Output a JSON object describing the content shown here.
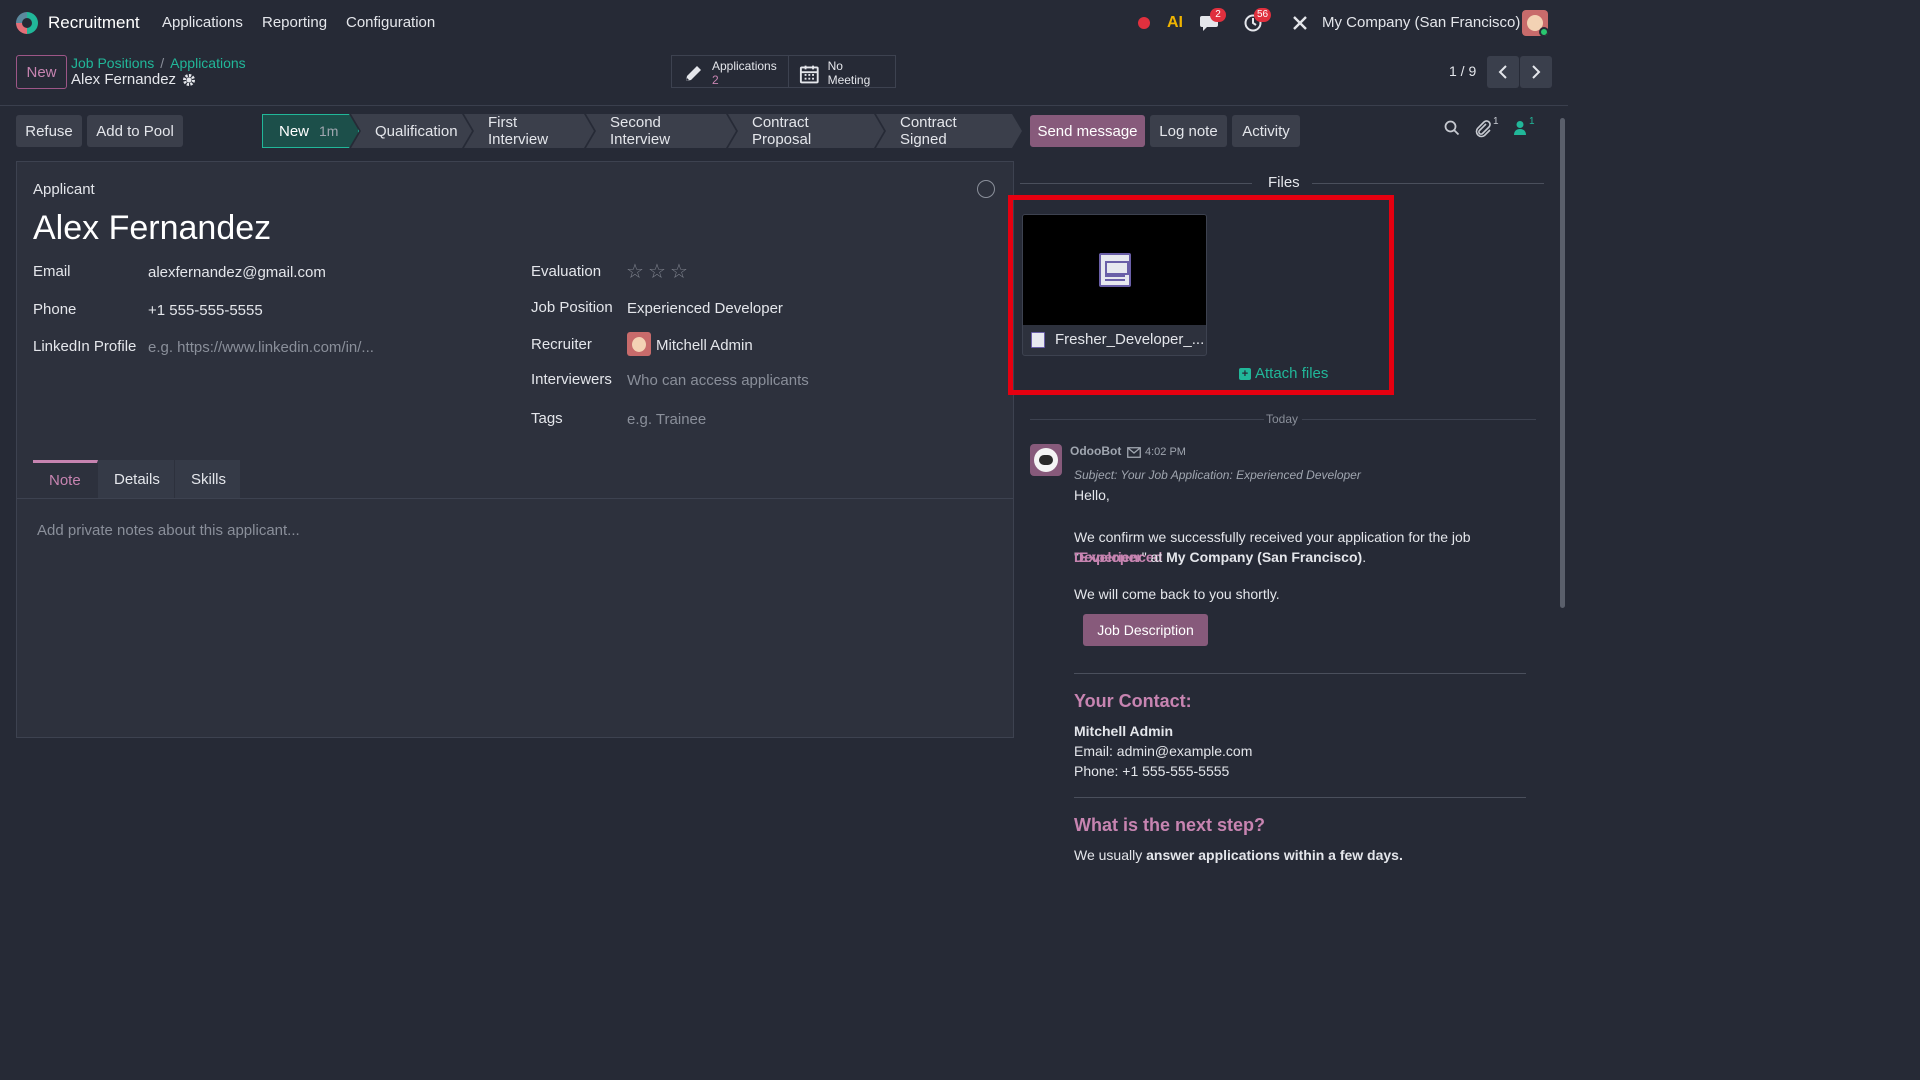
{
  "app": {
    "name": "Recruitment",
    "menu": [
      "Applications",
      "Reporting",
      "Configuration"
    ],
    "company": "My Company (San Francisco)",
    "messages_badge": "2",
    "activities_badge": "56",
    "ai_label": "AI"
  },
  "control": {
    "new_label": "New",
    "breadcrumb": [
      "Job Positions",
      "Applications"
    ],
    "record_title": "Alex Fernandez",
    "smart_buttons": {
      "applications_label": "Applications",
      "applications_count": "2",
      "meeting_label": "No Meeting"
    },
    "pager": "1 / 9"
  },
  "actions": {
    "refuse": "Refuse",
    "add_to_pool": "Add to Pool"
  },
  "stages": [
    {
      "label": "New",
      "age": "1m"
    },
    {
      "label": "Qualification"
    },
    {
      "label": "First Interview"
    },
    {
      "label": "Second Interview"
    },
    {
      "label": "Contract Proposal"
    },
    {
      "label": "Contract Signed"
    }
  ],
  "chatter_actions": {
    "send_message": "Send message",
    "log_note": "Log note",
    "activity": "Activity",
    "attachments_count": "1",
    "followers_count": "1"
  },
  "form": {
    "section_label": "Applicant",
    "name": "Alex Fernandez",
    "email_label": "Email",
    "email": "alexfernandez@gmail.com",
    "phone_label": "Phone",
    "phone": "+1 555-555-5555",
    "linkedin_label": "LinkedIn Profile",
    "linkedin_placeholder": "e.g. https://www.linkedin.com/in/...",
    "evaluation_label": "Evaluation",
    "evaluation_stars": 0,
    "job_position_label": "Job Position",
    "job_position": "Experienced Developer",
    "recruiter_label": "Recruiter",
    "recruiter": "Mitchell Admin",
    "interviewers_label": "Interviewers",
    "interviewers_placeholder": "Who can access applicants",
    "tags_label": "Tags",
    "tags_placeholder": "e.g. Trainee"
  },
  "tabs": [
    "Note",
    "Details",
    "Skills"
  ],
  "note_placeholder": "Add private notes about this applicant...",
  "files": {
    "heading": "Files",
    "file_name": "Fresher_Developer_...",
    "attach_label": "Attach files"
  },
  "chatter": {
    "date_separator": "Today",
    "author": "OdooBot",
    "time": "4:02 PM",
    "subject": "Subject: Your Job Application: Experienced Developer",
    "greeting": "Hello,",
    "line1_pre": "We confirm we successfully received your application for the job \"",
    "line1_job_a": "Experienced",
    "line1_job_b": "Developer",
    "line1_mid": "\" at ",
    "line1_company": "My Company (San Francisco)",
    "line1_end": ".",
    "line2": "We will come back to you shortly.",
    "job_desc_button": "Job Description",
    "contact_heading": "Your Contact:",
    "contact_name": "Mitchell Admin",
    "contact_email": "Email: admin@example.com",
    "contact_phone": "Phone: +1 555-555-5555",
    "next_heading": "What is the next step?",
    "next_pre": "We usually ",
    "next_bold": "answer applications within a few days."
  },
  "colors": {
    "accent": "#875a7b",
    "teal": "#21b799",
    "highlight_box": "#e50010"
  }
}
